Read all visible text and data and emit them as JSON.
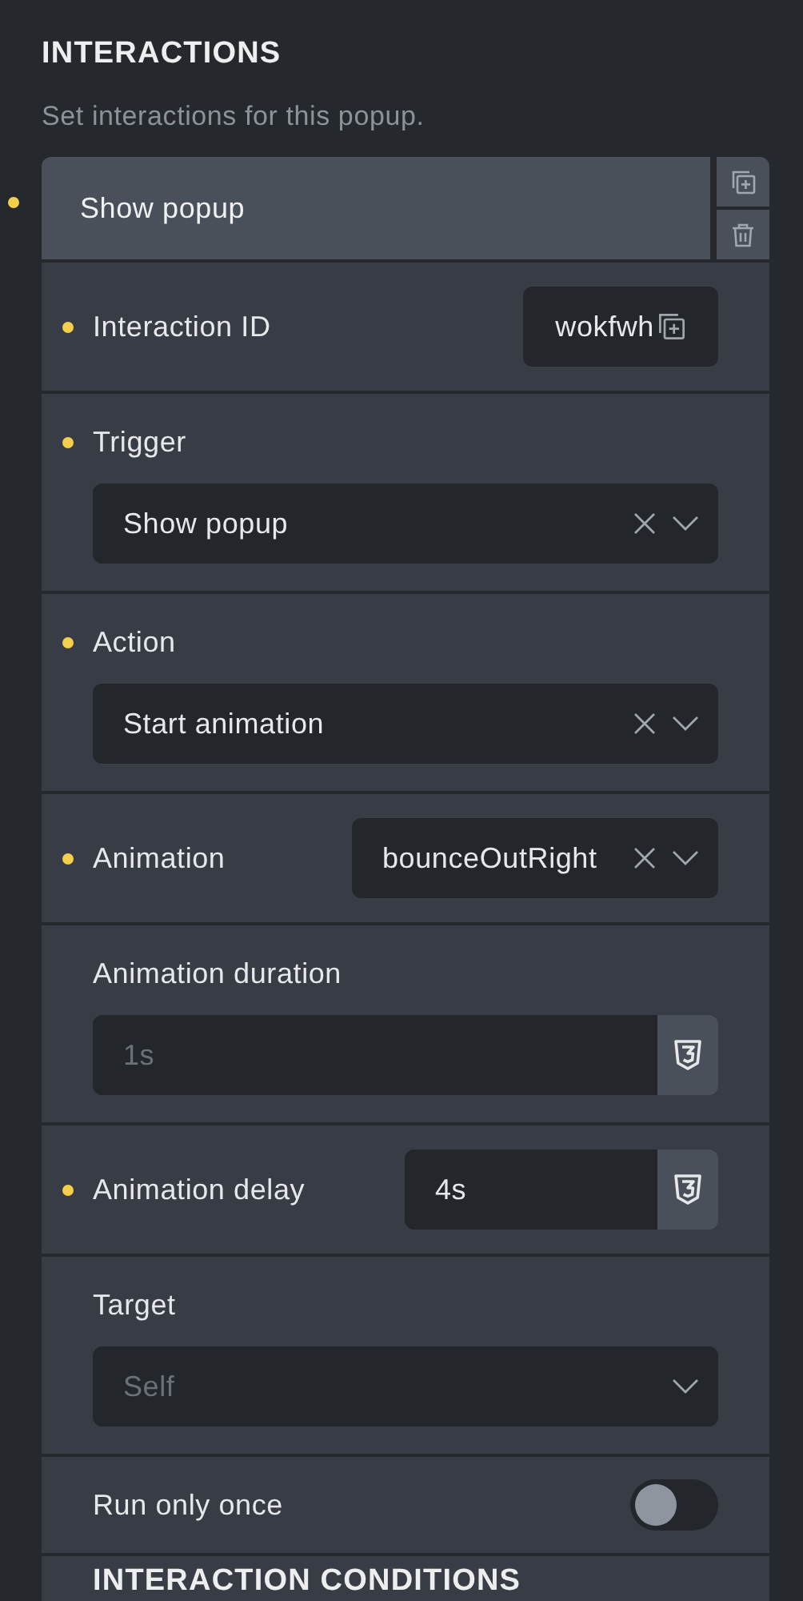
{
  "section": {
    "title": "INTERACTIONS",
    "description": "Set interactions for this popup."
  },
  "interaction": {
    "title": "Show popup",
    "modified": true
  },
  "fields": [
    {
      "kind": "id",
      "label": "Interaction ID",
      "modified": true,
      "value": "wokfwh"
    },
    {
      "kind": "select",
      "label": "Trigger",
      "modified": true,
      "value": "Show popup",
      "clearable": true
    },
    {
      "kind": "select",
      "label": "Action",
      "modified": true,
      "value": "Start animation",
      "clearable": true
    },
    {
      "kind": "inline-select",
      "label": "Animation",
      "modified": true,
      "value": "bounceOutRight",
      "clearable": true
    },
    {
      "kind": "css-input",
      "label": "Animation duration",
      "modified": false,
      "placeholder": "1s"
    },
    {
      "kind": "inline-css-input",
      "label": "Animation delay",
      "modified": true,
      "value": "4s"
    },
    {
      "kind": "select",
      "label": "Target",
      "modified": false,
      "placeholder": "Self",
      "clearable": false
    },
    {
      "kind": "toggle",
      "label": "Run only once",
      "modified": false,
      "on": false
    }
  ],
  "next_section": {
    "title": "INTERACTION CONDITIONS"
  }
}
